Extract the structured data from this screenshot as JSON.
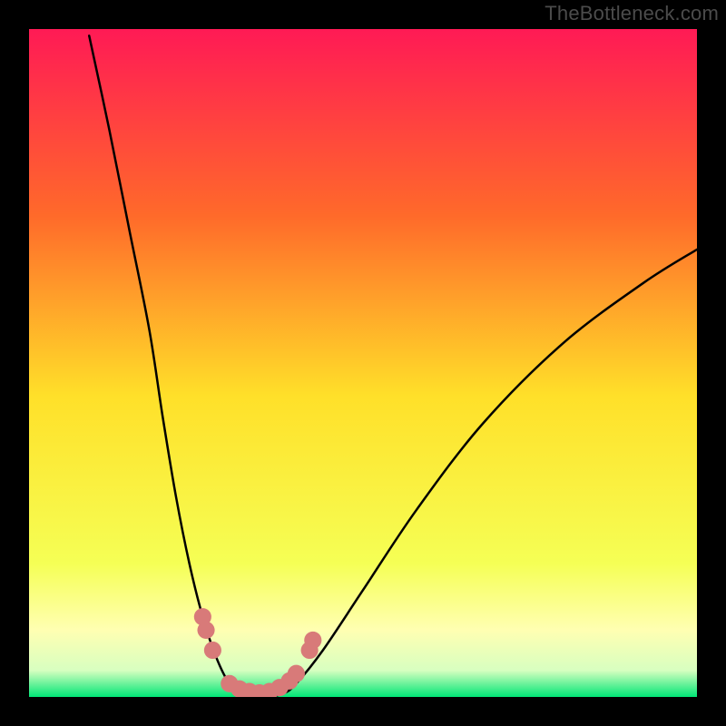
{
  "watermark": "TheBottleneck.com",
  "chart_data": {
    "type": "line",
    "title": "",
    "xlabel": "",
    "ylabel": "",
    "xlim": [
      0,
      100
    ],
    "ylim": [
      0,
      100
    ],
    "background_gradient": {
      "top": "#ff1a55",
      "mid_upper": "#ff6a2a",
      "mid": "#ffe029",
      "mid_lower": "#f5ff55",
      "band": "#ffffb2",
      "bottom": "#00e676"
    },
    "frame_color": "#000000",
    "curve": {
      "name": "bottleneck-curve",
      "color": "#000000",
      "points": [
        {
          "x": 9,
          "y": 99
        },
        {
          "x": 12,
          "y": 85
        },
        {
          "x": 15,
          "y": 70
        },
        {
          "x": 18,
          "y": 55
        },
        {
          "x": 20,
          "y": 42
        },
        {
          "x": 22,
          "y": 30
        },
        {
          "x": 24,
          "y": 20
        },
        {
          "x": 26,
          "y": 12
        },
        {
          "x": 28,
          "y": 6
        },
        {
          "x": 30,
          "y": 2
        },
        {
          "x": 32,
          "y": 0.5
        },
        {
          "x": 35,
          "y": 0
        },
        {
          "x": 38,
          "y": 0.5
        },
        {
          "x": 40,
          "y": 2
        },
        {
          "x": 44,
          "y": 7
        },
        {
          "x": 50,
          "y": 16
        },
        {
          "x": 58,
          "y": 28
        },
        {
          "x": 68,
          "y": 41
        },
        {
          "x": 80,
          "y": 53
        },
        {
          "x": 92,
          "y": 62
        },
        {
          "x": 100,
          "y": 67
        }
      ]
    },
    "markers": {
      "name": "highlight-points",
      "color": "#d87a79",
      "radius": 1.3,
      "points": [
        {
          "x": 26.0,
          "y": 12.0
        },
        {
          "x": 26.5,
          "y": 10.0
        },
        {
          "x": 27.5,
          "y": 7.0
        },
        {
          "x": 30.0,
          "y": 2.0
        },
        {
          "x": 31.5,
          "y": 1.2
        },
        {
          "x": 33.0,
          "y": 0.8
        },
        {
          "x": 34.5,
          "y": 0.6
        },
        {
          "x": 36.0,
          "y": 0.8
        },
        {
          "x": 37.5,
          "y": 1.4
        },
        {
          "x": 39.0,
          "y": 2.4
        },
        {
          "x": 40.0,
          "y": 3.5
        },
        {
          "x": 42.0,
          "y": 7.0
        },
        {
          "x": 42.5,
          "y": 8.5
        }
      ]
    }
  }
}
